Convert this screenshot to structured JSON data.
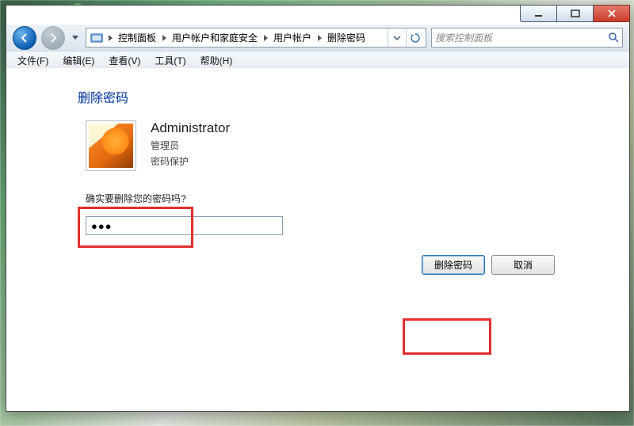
{
  "caption_buttons": {
    "minimize_tip": "minimize",
    "maximize_tip": "maximize",
    "close_tip": "close"
  },
  "breadcrumb": {
    "items": [
      "控制面板",
      "用户帐户和家庭安全",
      "用户帐户",
      "删除密码"
    ]
  },
  "search": {
    "placeholder": "搜索控制面板"
  },
  "menubar": {
    "file": "文件(F)",
    "edit": "编辑(E)",
    "view": "查看(V)",
    "tools": "工具(T)",
    "help": "帮助(H)"
  },
  "page": {
    "title": "删除密码",
    "username": "Administrator",
    "role": "管理员",
    "protection": "密码保护",
    "question": "确实要删除您的密码吗?",
    "password_mask": "●●●"
  },
  "buttons": {
    "delete": "删除密码",
    "cancel": "取消"
  }
}
